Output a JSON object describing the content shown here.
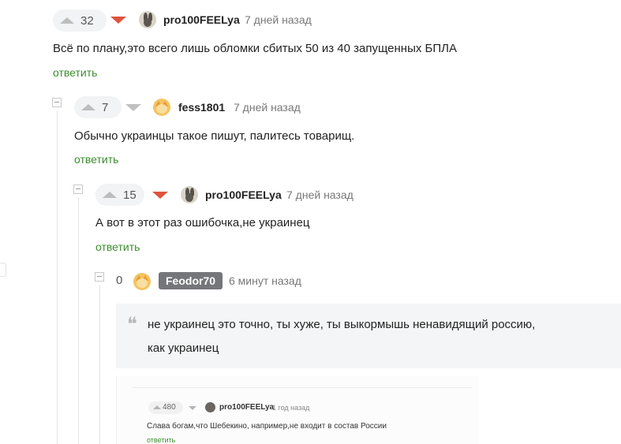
{
  "comments": [
    {
      "rating": "32",
      "username": "pro100FEELya",
      "time": "7 дней назад",
      "text": "Всё по плану,это всего лишь обломки сбитых 50 из 40 запущенных БПЛА",
      "reply_label": "ответить",
      "avatar_icon": "rabbit-avatar-icon"
    },
    {
      "rating": "7",
      "username": "fess1801",
      "time": "7 дней назад",
      "text": "Обычно украинцы такое пишут, палитесь товарищ.",
      "reply_label": "ответить",
      "avatar_icon": "fox-avatar-icon"
    },
    {
      "rating": "15",
      "username": "pro100FEELya",
      "time": "7 дней назад",
      "text": "А вот в этот раз ошибочка,не украинец",
      "reply_label": "ответить",
      "avatar_icon": "rabbit-avatar-icon"
    },
    {
      "rating": "0",
      "username": "Feodor70",
      "time": "6 минут назад",
      "quote_lines": [
        "не украинец это точно, ты хуже, ты выкормышь ненавидящий россию,",
        "как украинец"
      ],
      "avatar_icon": "fox-avatar-icon"
    }
  ],
  "embedded_screenshot": {
    "rating": "480",
    "username": "pro100FEELya",
    "time": "1 год назад",
    "text": "Слава богам,что Шебекино, например,не входит в состав России",
    "reply_label": "ответить"
  },
  "colors": {
    "downvote_active": "#e0533e",
    "reply_link": "#3c8d2f",
    "username_badge": "#747679"
  }
}
